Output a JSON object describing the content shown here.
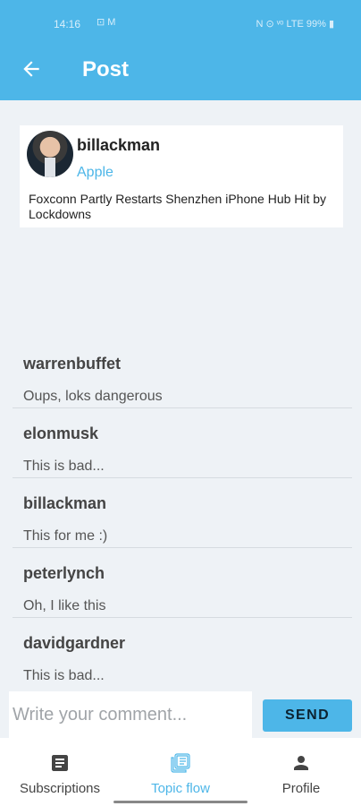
{
  "status_bar": {
    "time": "14:16",
    "icons_left": "⊡ M",
    "right": "N ⊙ ᵛᵒ LTE 99% ▮"
  },
  "app_bar": {
    "back_icon": "arrow-left-icon",
    "title": "Post"
  },
  "post": {
    "username": "billackman",
    "topic": "Apple",
    "text": "Foxconn Partly Restarts Shenzhen iPhone Hub Hit by Lockdowns"
  },
  "comments": [
    {
      "user": "warrenbuffet",
      "text": "Oups, loks dangerous"
    },
    {
      "user": "elonmusk",
      "text": "This is bad..."
    },
    {
      "user": "billackman",
      "text": "This for me :)"
    },
    {
      "user": "peterlynch",
      "text": "Oh, I like this"
    },
    {
      "user": "davidgardner",
      "text": "This is bad..."
    }
  ],
  "composer": {
    "placeholder": "Write your comment...",
    "send_label": "SEND"
  },
  "bottom_nav": {
    "items": [
      {
        "label": "Subscriptions",
        "icon": "article-icon"
      },
      {
        "label": "Topic flow",
        "icon": "collections-icon",
        "active": true
      },
      {
        "label": "Profile",
        "icon": "person-icon"
      }
    ]
  },
  "colors": {
    "accent": "#4db6e8",
    "background": "#eef2f6"
  }
}
